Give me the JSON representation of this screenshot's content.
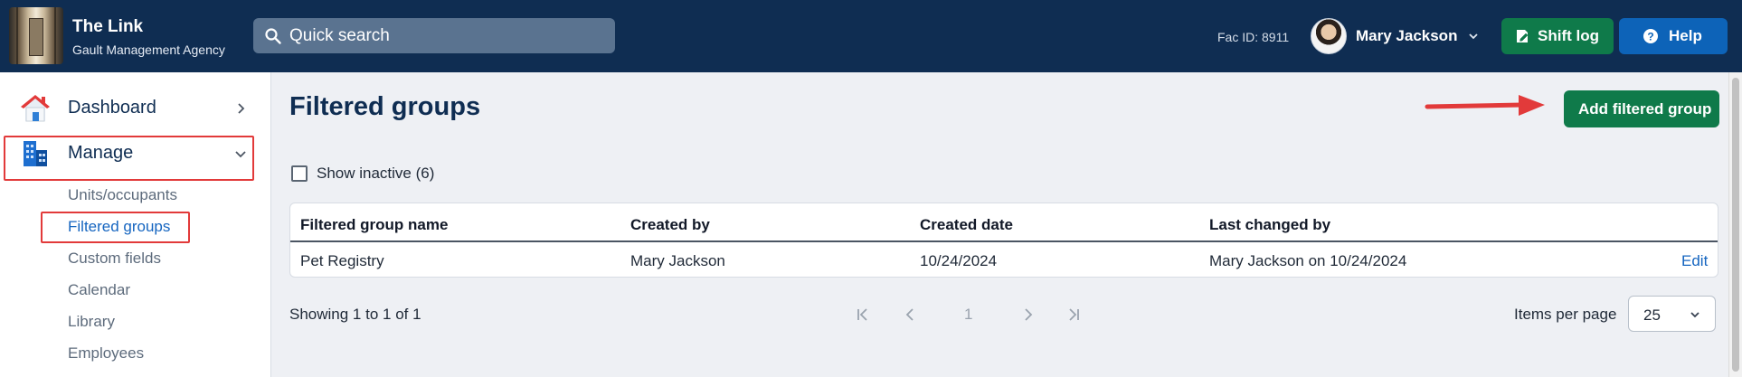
{
  "app": {
    "title": "The Link",
    "subtitle": "Gault Management Agency",
    "logo_icon": "hallway-logo"
  },
  "search": {
    "placeholder": "Quick search",
    "icon": "search-icon"
  },
  "header": {
    "fac_id": "Fac ID: 8911",
    "user_name": "Mary Jackson",
    "shift_log_label": "Shift log",
    "help_label": "Help"
  },
  "sidebar": {
    "items": [
      {
        "label": "Dashboard",
        "icon": "house-icon",
        "expanded": false
      },
      {
        "label": "Manage",
        "icon": "building-icon",
        "expanded": true
      }
    ],
    "subitems": [
      {
        "label": "Units/occupants",
        "active": false
      },
      {
        "label": "Filtered groups",
        "active": true
      },
      {
        "label": "Custom fields",
        "active": false
      },
      {
        "label": "Calendar",
        "active": false
      },
      {
        "label": "Library",
        "active": false
      },
      {
        "label": "Employees",
        "active": false
      }
    ]
  },
  "main": {
    "title": "Filtered groups",
    "add_button": "Add filtered group",
    "show_inactive": {
      "label": "Show inactive (6)",
      "checked": false
    },
    "table": {
      "headers": [
        "Filtered group name",
        "Created by",
        "Created date",
        "Last changed by"
      ],
      "rows": [
        {
          "name": "Pet Registry",
          "created_by": "Mary Jackson",
          "created_date": "10/24/2024",
          "last_changed": "Mary Jackson on 10/24/2024",
          "action": "Edit"
        }
      ]
    },
    "pagination": {
      "showing": "Showing 1 to 1 of 1",
      "current_page": "1",
      "items_per_page_label": "Items per page",
      "items_per_page": "25"
    }
  },
  "colors": {
    "topbar": "#0f2d52",
    "green": "#0f7a4a",
    "blue": "#0d63b8",
    "highlight": "#e23a3a",
    "link": "#1565c0"
  }
}
